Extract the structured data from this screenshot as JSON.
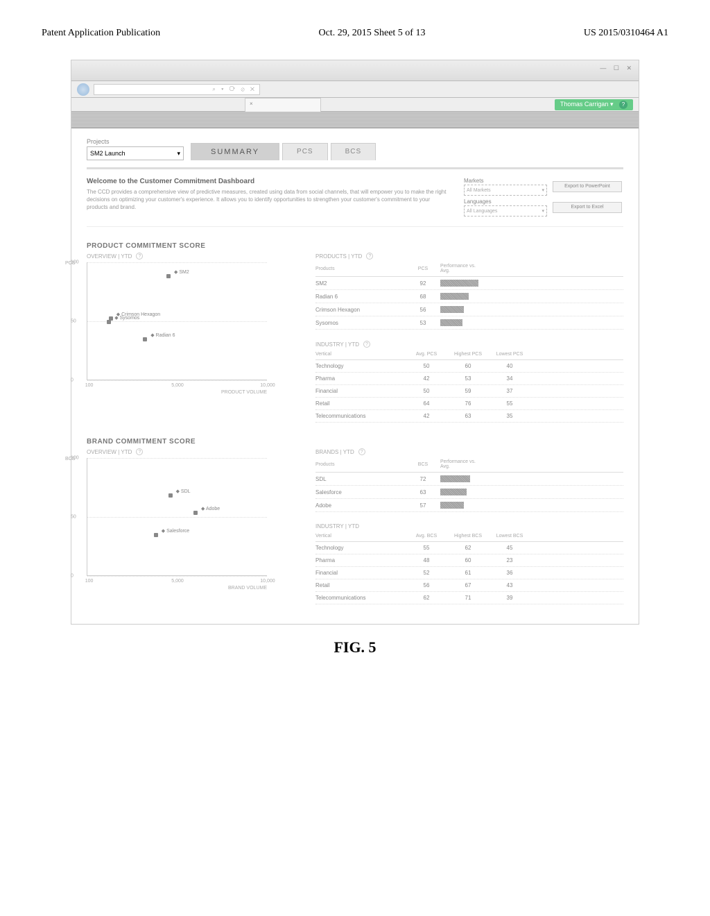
{
  "header": {
    "left": "Patent Application Publication",
    "center": "Oct. 29, 2015  Sheet 5 of 13",
    "right": "US 2015/0310464 A1"
  },
  "browser": {
    "addr_placeholder": "",
    "search_icons": "⌕ ▾ ⟳ ⊘ ✕",
    "tab_title": "×",
    "user": "Thomas Carrigan",
    "win_controls": "— ☐ ✕"
  },
  "project": {
    "label": "Projects",
    "selected": "SM2 Launch"
  },
  "tabs": [
    {
      "label": "SUMMARY",
      "active": true
    },
    {
      "label": "PCS",
      "active": false
    },
    {
      "label": "BCS",
      "active": false
    }
  ],
  "welcome": {
    "title": "Welcome to the Customer Commitment Dashboard",
    "body": "The CCD provides a comprehensive view of predictive measures, created using data from social channels, that will empower you to make the right decisions on optimizing your customer's experience. It allows you to identify opportunities to strengthen your customer's commitment to your products and brand."
  },
  "filters": {
    "markets_label": "Markets",
    "markets_value": "All Markets",
    "languages_label": "Languages",
    "languages_value": "All Languages",
    "export_ppt": "Export to PowerPoint",
    "export_xls": "Export to Excel"
  },
  "pcs": {
    "section_title": "PRODUCT COMMITMENT SCORE",
    "overview_label": "OVERVIEW | YTD",
    "products_label": "PRODUCTS | YTD",
    "industry_label": "INDUSTRY | YTD",
    "products_headers": {
      "name": "Products",
      "v": "PCS",
      "bar": "Performance vs. Avg."
    },
    "products": [
      {
        "name": "SM2",
        "v": "92"
      },
      {
        "name": "Radian 6",
        "v": "68"
      },
      {
        "name": "Crimson Hexagon",
        "v": "56"
      },
      {
        "name": "Sysomos",
        "v": "53"
      }
    ],
    "industry_headers": {
      "name": "Vertical",
      "a": "Avg. PCS",
      "b": "Highest PCS",
      "c": "Lowest PCS"
    },
    "industry": [
      {
        "name": "Technology",
        "a": "50",
        "b": "60",
        "c": "40"
      },
      {
        "name": "Pharma",
        "a": "42",
        "b": "53",
        "c": "34"
      },
      {
        "name": "Financial",
        "a": "50",
        "b": "59",
        "c": "37"
      },
      {
        "name": "Retail",
        "a": "64",
        "b": "76",
        "c": "55"
      },
      {
        "name": "Telecommunications",
        "a": "42",
        "b": "63",
        "c": "35"
      }
    ]
  },
  "bcs": {
    "section_title": "BRAND COMMITMENT SCORE",
    "overview_label": "OVERVIEW | YTD",
    "brands_label": "BRANDS | YTD",
    "industry_label": "INDUSTRY | YTD",
    "brands_headers": {
      "name": "Products",
      "v": "BCS",
      "bar": "Performance vs. Avg."
    },
    "brands": [
      {
        "name": "SDL",
        "v": "72"
      },
      {
        "name": "Salesforce",
        "v": "63"
      },
      {
        "name": "Adobe",
        "v": "57"
      }
    ],
    "industry_headers": {
      "name": "Vertical",
      "a": "Avg. BCS",
      "b": "Highest BCS",
      "c": "Lowest BCS"
    },
    "industry": [
      {
        "name": "Technology",
        "a": "55",
        "b": "62",
        "c": "45"
      },
      {
        "name": "Pharma",
        "a": "48",
        "b": "60",
        "c": "23"
      },
      {
        "name": "Financial",
        "a": "52",
        "b": "61",
        "c": "36"
      },
      {
        "name": "Retail",
        "a": "56",
        "b": "67",
        "c": "43"
      },
      {
        "name": "Telecommunications",
        "a": "62",
        "b": "71",
        "c": "39"
      }
    ]
  },
  "chart_data": [
    {
      "type": "scatter",
      "title": "PCS Overview",
      "xlabel": "PRODUCT VOLUME",
      "ylabel": "PCS",
      "xlim": [
        0,
        10000
      ],
      "ylim": [
        0,
        100
      ],
      "xticks": [
        100,
        5000,
        10000
      ],
      "yticks": [
        0,
        50,
        100
      ],
      "series": [
        {
          "name": "products",
          "points": [
            {
              "label": "SM2",
              "x": 4500,
              "y": 92
            },
            {
              "label": "Sysomos",
              "x": 1200,
              "y": 53
            },
            {
              "label": "Crimson Hexagon",
              "x": 1300,
              "y": 56
            },
            {
              "label": "Radian 6",
              "x": 3200,
              "y": 38
            }
          ]
        }
      ]
    },
    {
      "type": "scatter",
      "title": "BCS Overview",
      "xlabel": "BRAND VOLUME",
      "ylabel": "BCS",
      "xlim": [
        0,
        10000
      ],
      "ylim": [
        0,
        100
      ],
      "xticks": [
        100,
        5000,
        10000
      ],
      "yticks": [
        0,
        50,
        100
      ],
      "series": [
        {
          "name": "brands",
          "points": [
            {
              "label": "SDL",
              "x": 4600,
              "y": 72
            },
            {
              "label": "Adobe",
              "x": 6000,
              "y": 57
            },
            {
              "label": "Salesforce",
              "x": 3800,
              "y": 38
            }
          ]
        }
      ]
    }
  ],
  "figure_caption": "FIG. 5"
}
